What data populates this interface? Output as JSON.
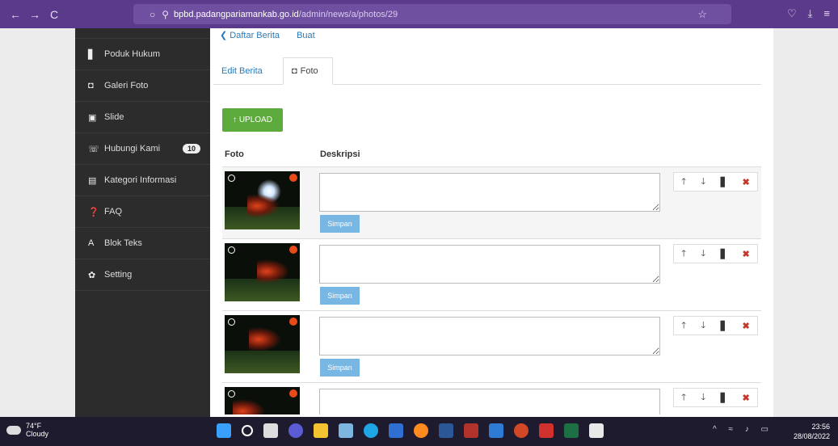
{
  "browser": {
    "url_host": "bpbd.padangpariamankab.go.id",
    "url_path": "/admin/news/a/photos/29",
    "back": "←",
    "forward": "→",
    "reload": "C"
  },
  "sidebar": {
    "items": [
      {
        "label": "Poduk Hukum",
        "icon": "▋"
      },
      {
        "label": "Galeri Foto",
        "icon": "◘"
      },
      {
        "label": "Slide",
        "icon": "▣"
      },
      {
        "label": "Hubungi Kami",
        "icon": "☏",
        "badge": "10"
      },
      {
        "label": "Kategori Informasi",
        "icon": "▤"
      },
      {
        "label": "FAQ",
        "icon": "❓"
      },
      {
        "label": "Blok Teks",
        "icon": "A"
      },
      {
        "label": "Setting",
        "icon": "✿"
      }
    ]
  },
  "breadcrumb": {
    "back": "❮ Daftar Berita",
    "create": "Buat"
  },
  "tabs": {
    "edit": "Edit Berita",
    "photo": "Foto"
  },
  "upload_label": "↑ UPLOAD",
  "table": {
    "col_photo": "Foto",
    "col_desc": "Deskripsi",
    "save_label": "Simpan",
    "rows": [
      {
        "description": ""
      },
      {
        "description": ""
      },
      {
        "description": ""
      },
      {
        "description": ""
      }
    ]
  },
  "taskbar": {
    "temp": "74°F",
    "weather": "Cloudy",
    "time": "23:56",
    "date": "28/08/2022"
  }
}
